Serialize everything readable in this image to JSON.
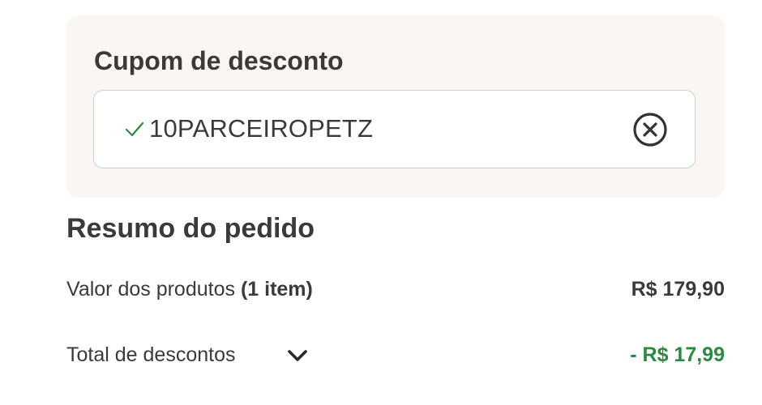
{
  "coupon": {
    "title": "Cupom de desconto",
    "code": "10PARCEIROPETZ",
    "status_icon": "check-icon",
    "clear_icon": "clear-circle-x-icon",
    "accent_color": "#2a8a3e"
  },
  "summary": {
    "title": "Resumo do pedido",
    "products_label": "Valor dos produtos",
    "products_count": "(1 item)",
    "products_value": "R$ 179,90",
    "discounts_label": "Total de descontos",
    "discounts_toggle_icon": "chevron-down-icon",
    "discounts_value": "- R$ 17,99",
    "discount_color": "#2a8a3e"
  }
}
